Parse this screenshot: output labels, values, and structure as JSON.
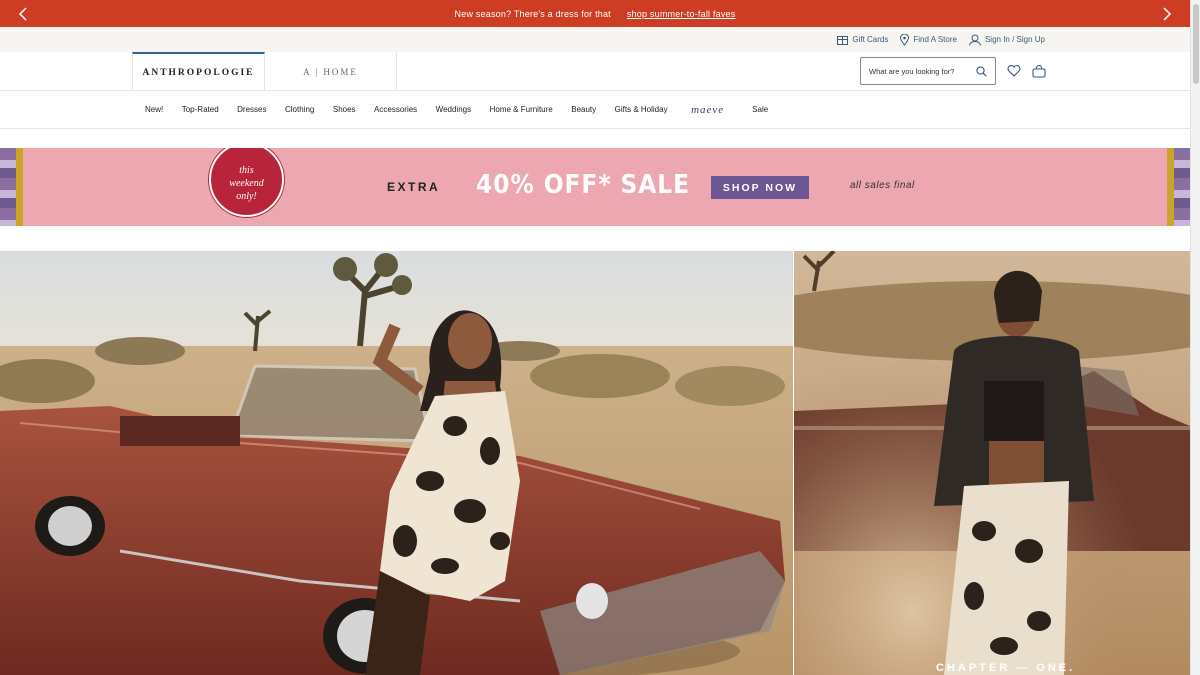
{
  "promo": {
    "message": "New season? There's a dress for that",
    "link": "shop summer-to-fall faves"
  },
  "utility": {
    "gift_cards": "Gift Cards",
    "find_store": "Find A Store",
    "sign_in": "Sign In / Sign Up"
  },
  "header": {
    "brand_anthro": "ANTHROPOLOGIE",
    "brand_home": "A | HOME",
    "search_placeholder": "What are you looking for?"
  },
  "nav": {
    "items": [
      "New!",
      "Top-Rated",
      "Dresses",
      "Clothing",
      "Shoes",
      "Accessories",
      "Weddings",
      "Home & Furniture",
      "Beauty",
      "Gifts & Holiday",
      "maeve",
      "Sale"
    ]
  },
  "banner": {
    "badge_line1": "this",
    "badge_line2": "weekend",
    "badge_line3": "only!",
    "extra": "EXTRA",
    "sale": "40% OFF* SALE",
    "cta": "SHOP NOW",
    "note": "all sales final"
  },
  "hero": {
    "right_caption": "CHAPTER — ONE."
  },
  "colors": {
    "promo_bg": "#cc3d23",
    "banner_bg": "#eda7b0",
    "cta_bg": "#6d5691",
    "badge_bg": "#b8253b"
  }
}
